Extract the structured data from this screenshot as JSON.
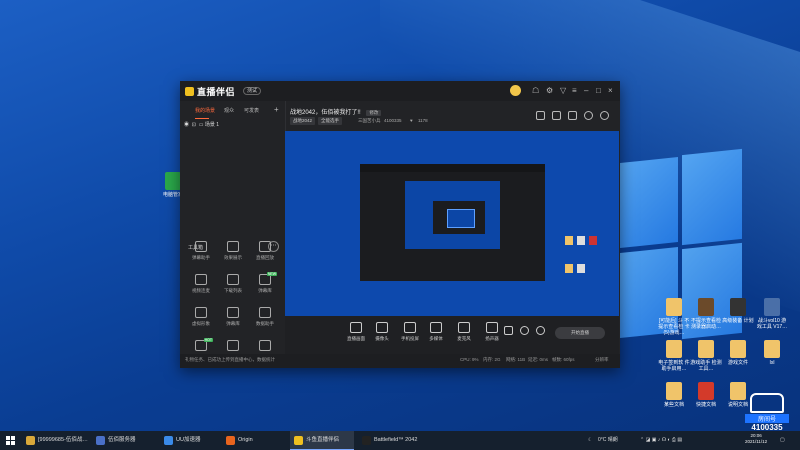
{
  "app": {
    "logo_text": "直播伴侣",
    "version_badge": "测试",
    "sidebar_tabs": [
      "我的场景",
      "观众",
      "可发表"
    ],
    "scene_label": "场景 1",
    "tools_header": "工具箱",
    "tools": [
      {
        "label": "弹幕助手",
        "icon": "danmaku-icon"
      },
      {
        "label": "效果展示",
        "icon": "user-icon"
      },
      {
        "label": "直播回放",
        "icon": "replay-icon"
      },
      {
        "label": "视频连麦",
        "icon": "video-call-icon",
        "badge": ""
      },
      {
        "label": "下载列表",
        "icon": "download-icon"
      },
      {
        "label": "弹幕库",
        "icon": "library-icon",
        "badge": "NEW"
      },
      {
        "label": "虚拟形象",
        "icon": "avatar-icon"
      },
      {
        "label": "弹幕库",
        "icon": "folder-icon"
      },
      {
        "label": "数据助手",
        "icon": "data-icon"
      },
      {
        "label": "",
        "icon": "hot-icon",
        "badge": "HOT"
      },
      {
        "label": "",
        "icon": "download-icon"
      },
      {
        "label": "",
        "icon": "share-icon"
      }
    ],
    "room_title": "战地2042，伍佰被我打了!!",
    "room_edit": "修改",
    "category_chip": "战地2042",
    "mode_chip": "全能选手",
    "streamer": "三国苦小兵",
    "room_id": "4100335",
    "fans": "1178",
    "status_text": "礼物任务、已成功上传到直播中心，数据统计",
    "status_metrics": [
      "CPU: 9%",
      "内存: 2G",
      "网络: 11B",
      "延迟: 0ms",
      "帧数: 60fps",
      "分辨率"
    ],
    "controls": [
      "直播画面",
      "摄像头",
      "手机投屏",
      "多媒体",
      "麦克风",
      "扬声器"
    ],
    "start_button": "开始直播"
  },
  "desktop_icons": [
    {
      "label": "电脑管家",
      "color": "#2aa84a"
    },
    {
      "label": "[可能后] 斗 不提示查看检 卡(5)游戏…",
      "color": "#f0c46a"
    },
    {
      "label": "不提示查看检 测录器启动…",
      "color": "#6b4a2a"
    },
    {
      "label": "高级装备 计划",
      "color": "#333333"
    },
    {
      "label": "战斗vol10 游戏工具 V17…",
      "color": "#4a6fa8"
    },
    {
      "label": "电子签到软 件助手启用…",
      "color": "#f0c46a"
    },
    {
      "label": "游戏助手 检测工具…",
      "color": "#f0c46a"
    },
    {
      "label": "游戏文件",
      "color": "#f0c46a"
    },
    {
      "label": "Ixl",
      "color": "#f0c46a"
    },
    {
      "label": "某些文档",
      "color": "#f0c46a"
    },
    {
      "label": "快捷文档",
      "color": "#d33a2a"
    },
    {
      "label": "说明文档",
      "color": "#f0c46a"
    }
  ],
  "taskbar": {
    "items": [
      {
        "label": "[99999685-伍佰战…",
        "color": "#d9a83a"
      },
      {
        "label": "伍佰服务器",
        "color": "#4a70c8"
      },
      {
        "label": "UU加速器",
        "color": "#3a8ae8"
      },
      {
        "label": "Origin",
        "color": "#e8641e"
      },
      {
        "label": "斗鱼直播伴侣",
        "color": "#f0c020",
        "active": true
      },
      {
        "label": "Battlefield™ 2042",
        "color": "#222222"
      }
    ],
    "weather": "0°C 晴朗",
    "time": "20:06",
    "date": "2021/11/12"
  },
  "watermark": {
    "brand": "斗鱼",
    "tag": "房间号",
    "room_id": "4100335"
  }
}
